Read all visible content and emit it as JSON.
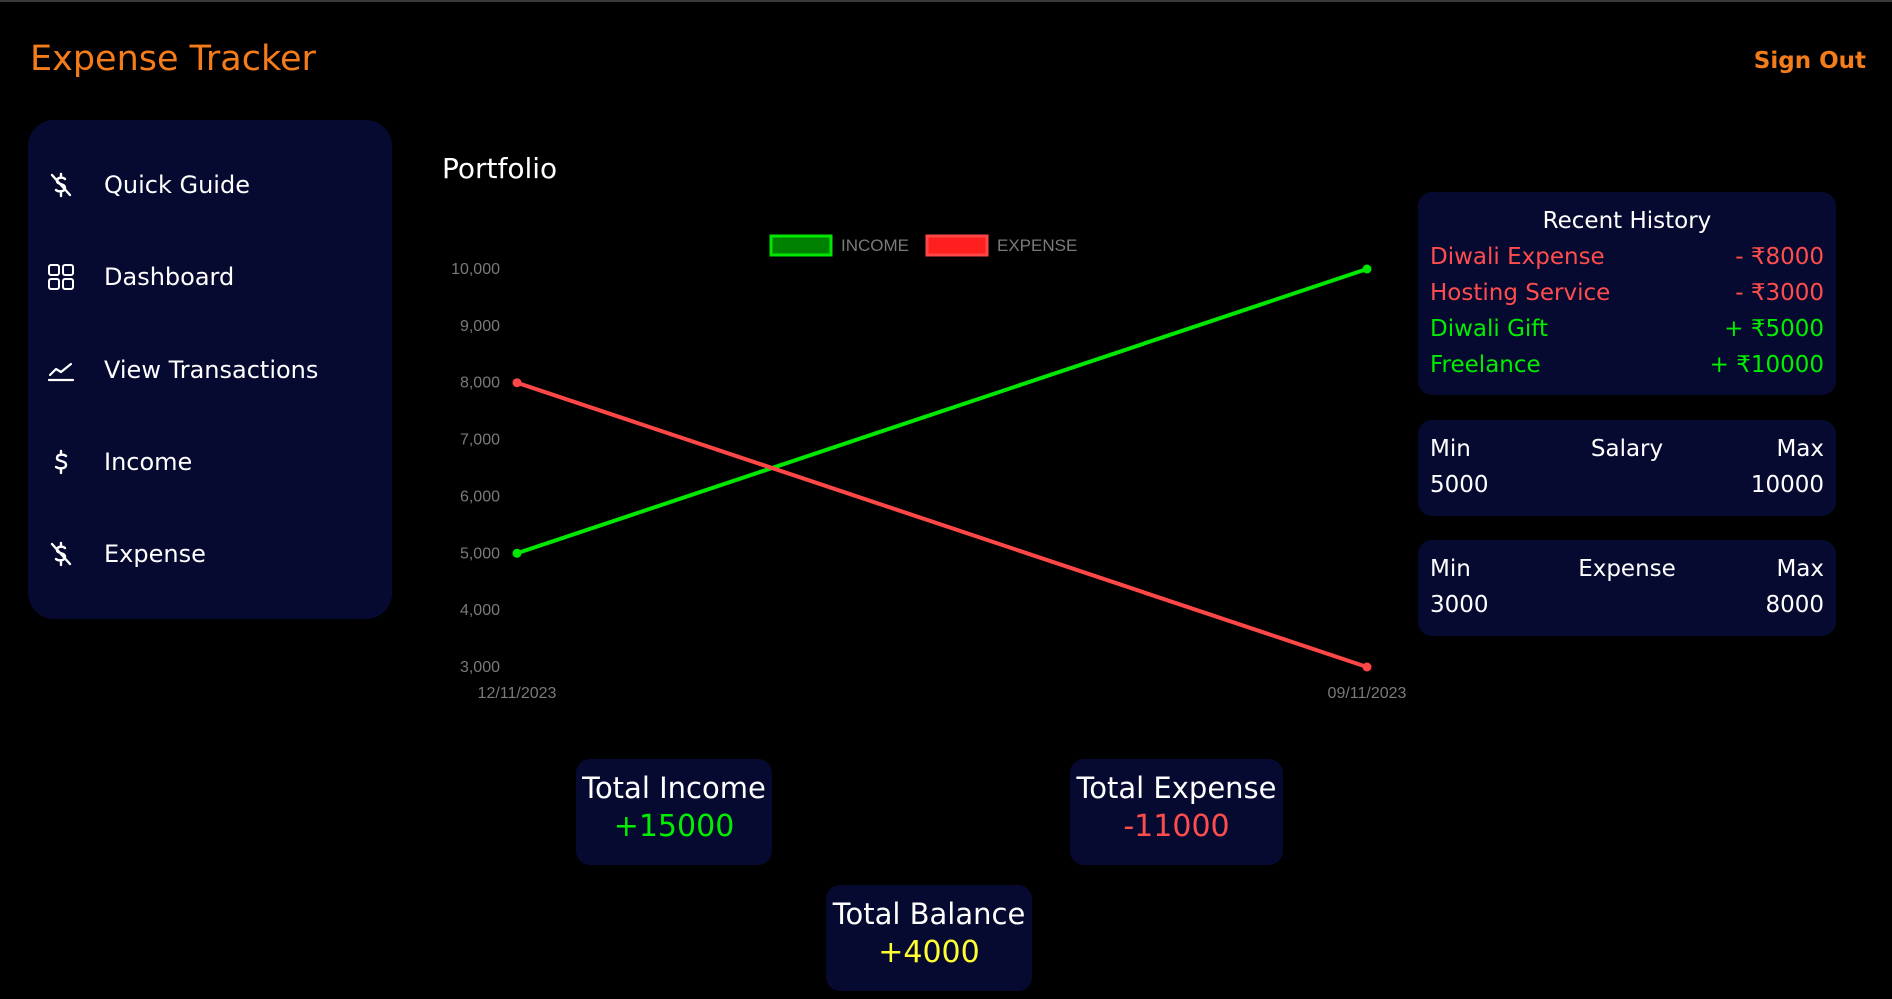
{
  "header": {
    "title": "Expense Tracker",
    "signout_label": "Sign Out"
  },
  "sidebar": {
    "items": [
      {
        "label": "Quick Guide",
        "icon": "dollar-off-icon"
      },
      {
        "label": "Dashboard",
        "icon": "grid-icon"
      },
      {
        "label": "View Transactions",
        "icon": "trend-icon"
      },
      {
        "label": "Income",
        "icon": "dollar-icon"
      },
      {
        "label": "Expense",
        "icon": "dollar-off-icon"
      }
    ]
  },
  "main": {
    "title": "Portfolio"
  },
  "chart_data": {
    "type": "line",
    "x": [
      "12/11/2023",
      "09/11/2023"
    ],
    "series": [
      {
        "name": "INCOME",
        "values": [
          5000,
          10000
        ],
        "color": "#00e800"
      },
      {
        "name": "EXPENSE",
        "values": [
          8000,
          3000
        ],
        "color": "#ff4747"
      }
    ],
    "ylim": [
      3000,
      10000
    ],
    "yticks": [
      "3,000",
      "4,000",
      "5,000",
      "6,000",
      "7,000",
      "8,000",
      "9,000",
      "10,000"
    ],
    "legend": "top-center",
    "grid": false
  },
  "history": {
    "title": "Recent History",
    "items": [
      {
        "label": "Diwali Expense",
        "amount": "- ₹8000",
        "color": "#ff4d4d"
      },
      {
        "label": "Hosting Service",
        "amount": "- ₹3000",
        "color": "#ff4d4d"
      },
      {
        "label": "Diwali Gift",
        "amount": "+ ₹5000",
        "color": "#00ee00"
      },
      {
        "label": "Freelance",
        "amount": "+ ₹10000",
        "color": "#00ee00"
      }
    ]
  },
  "salary": {
    "min_label": "Min",
    "title": "Salary",
    "max_label": "Max",
    "min": "5000",
    "max": "10000"
  },
  "expense": {
    "min_label": "Min",
    "title": "Expense",
    "max_label": "Max",
    "min": "3000",
    "max": "8000"
  },
  "totals": {
    "income": {
      "label": "Total Income",
      "value": "+15000",
      "color": "#00ee00"
    },
    "expense": {
      "label": "Total Expense",
      "value": "-11000",
      "color": "#ff4d4d"
    },
    "balance": {
      "label": "Total Balance",
      "value": "+4000",
      "color": "#ffff33"
    }
  }
}
